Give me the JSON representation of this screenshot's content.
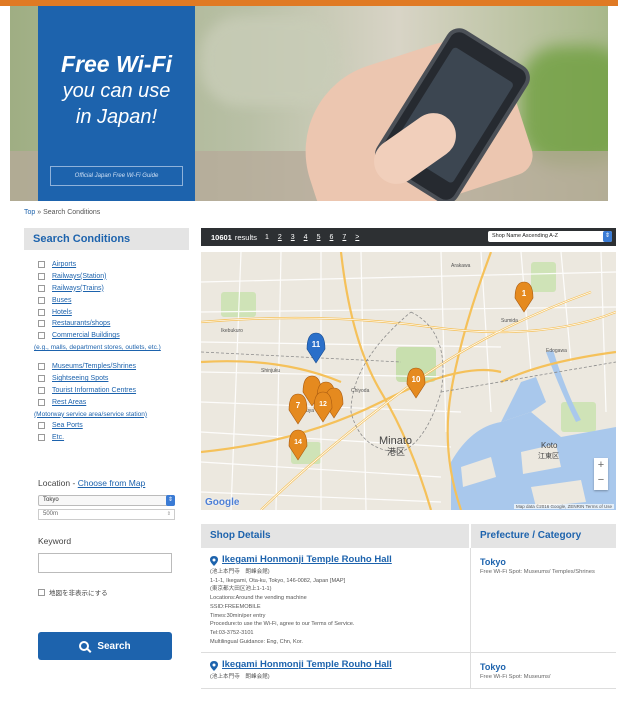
{
  "hero": {
    "title": "Free Wi-Fi",
    "line2": "you can use",
    "line3": "in Japan!",
    "guide_link": "Official Japan Free Wi-Fi Guide"
  },
  "breadcrumb": {
    "top": "Top",
    "sep": "»",
    "current": "Search Conditions"
  },
  "sidebar": {
    "heading": "Search Conditions",
    "categories": [
      "Airports",
      "Railways(Station)",
      "Railways(Trains)",
      "Buses",
      "Hotels",
      "Restaurants/shops",
      "Commercial Buildings"
    ],
    "commercial_note": "(e.g., malls, department stores, outlets, etc.)",
    "categories2": [
      "Museums/Temples/Shrines",
      "Sightseeing Spots",
      "Tourist Information Centres",
      "Rest Areas"
    ],
    "rest_note": "(Motorway service area/service station)",
    "categories3": [
      "Sea Ports",
      "Etc."
    ],
    "location_label": "Location -",
    "location_link": "Choose from Map",
    "location_value": "Tokyo",
    "radius_value": "500m",
    "keyword_label": "Keyword",
    "keyword_value": "",
    "map_toggle_label": "地図を非表示にする",
    "search_label": "Search"
  },
  "results": {
    "count": "10601",
    "unit": "results",
    "pages": [
      "1",
      "2",
      "3",
      "4",
      "5",
      "6",
      "7",
      ">"
    ],
    "sort_value": "Shop Name Ascending A-Z"
  },
  "map": {
    "markers": [
      "1",
      "11",
      "10",
      "7",
      "12",
      "14"
    ],
    "district": "Minato",
    "district_jp": "港区",
    "koto": "Koto",
    "koto_jp": "江東区",
    "google": "Google",
    "footer": "Map data ©2016 Google, ZENRIN  Terms of Use",
    "zoom_in": "+",
    "zoom_out": "−"
  },
  "table": {
    "col_shop": "Shop Details",
    "col_pref": "Prefecture / Category",
    "rows": [
      {
        "name": "Ikegami Honmonji Temple Rouho Hall",
        "name_jp": "(池上本門寺　朗峰会館)",
        "address": "1-1-1, Ikegami, Ota-ku, Tokyo, 146-0082, Japan   [MAP]",
        "address_jp": "(東京都大田区池上1-1-1)",
        "line1": "Locations:Around the vending machine",
        "line2": "SSID:FREEMOBILE",
        "line3": "Times:30min/per entry",
        "line4": "Procedure:to use the Wi-Fi, agree to our Terms of Service.",
        "line5": "Tel:03-3752-3101",
        "line6": "Multilingual Guidance: Eng, Chn, Kor.",
        "pref": "Tokyo",
        "category": "Free Wi-Fi Spot: Museums/ Temples/Shrines"
      },
      {
        "name": "Ikegami Honmonji Temple Rouho Hall",
        "name_jp": "(池上本門寺　朗峰会館)",
        "pref": "Tokyo",
        "category": "Free Wi-Fi Spot: Museums/"
      }
    ]
  },
  "colors": {
    "brand": "#1d63ad",
    "accent": "#e07a24",
    "marker": "#e58a1f",
    "marker_blue": "#2a6fc9"
  }
}
